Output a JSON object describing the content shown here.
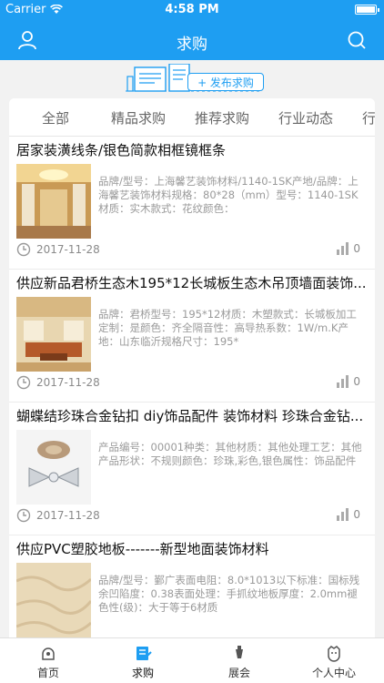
{
  "status": {
    "carrier": "Carrier",
    "time": "4:58 PM"
  },
  "nav": {
    "title": "求购",
    "left_icon": "user-icon",
    "right_icon": "search-icon"
  },
  "publish": {
    "button_label": "+ 发布求购"
  },
  "tabs": [
    "全部",
    "精品求购",
    "推荐求购",
    "行业动态",
    "行"
  ],
  "items": [
    {
      "title": "居家装潢线条/银色简款相框镜框条",
      "description": "品牌/型号：上海馨艺装饰材料/1140-1SK产地/品牌：上海馨艺装饰材料规格：80*28（mm）型号：1140-1SK材质：实木款式：花纹颜色：",
      "date": "2017-11-28",
      "views": "0"
    },
    {
      "title": "供应新品君桥生态木195*12长城板生态木吊顶墙面装饰...",
      "description": "品牌：君桥型号：195*12材质：木塑款式：长城板加工定制：是颜色：齐全隔音性：高导热系数：1W/m.K产地：山东临沂规格尺寸：195*",
      "date": "2017-11-28",
      "views": "0"
    },
    {
      "title": "蝴蝶结珍珠合金钻扣 diy饰品配件 装饰材料 珍珠合金钻...",
      "description": "产品编号：00001种类：其他材质：其他处理工艺：其他产品形状：不规则颜色：珍珠,彩色,银色属性：饰品配件",
      "date": "2017-11-28",
      "views": "0"
    },
    {
      "title": "供应PVC塑胶地板-------新型地面装饰材料",
      "description": "品牌/型号：鄞广表面电阻：8.0*1013以下标准：国标残余凹陷度：0.38表面处理：手抓纹地板厚度：2.0mm褪色性(级)：大于等于6材质",
      "date": "",
      "views": ""
    }
  ],
  "tabbar": [
    {
      "label": "首页",
      "icon": "home-icon"
    },
    {
      "label": "求购",
      "icon": "purchase-icon"
    },
    {
      "label": "展会",
      "icon": "exhibition-icon"
    },
    {
      "label": "个人中心",
      "icon": "profile-icon"
    }
  ],
  "colors": {
    "primary": "#1e9ef2",
    "background": "#f2f2f2"
  }
}
